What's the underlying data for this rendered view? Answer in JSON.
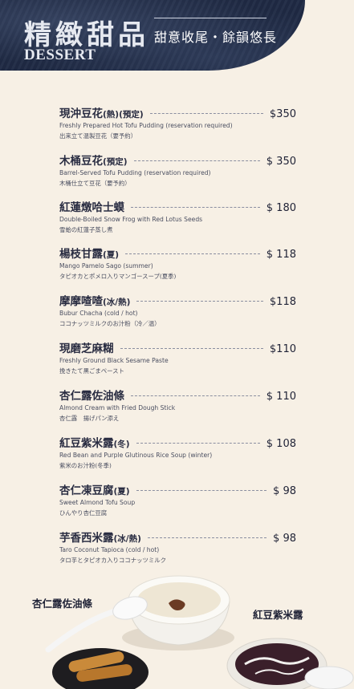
{
  "header": {
    "title_cn": "精緻甜品",
    "title_en": "DESSERT",
    "subtitle": "甜意收尾・餘韻悠長"
  },
  "items": [
    {
      "name": "現沖豆花",
      "tag": "(熱)(預定)",
      "price": "$350",
      "en": "Freshly Prepared Hot Tofu Pudding  (reservation required)",
      "jp": "出来立て温製豆花（要予約）"
    },
    {
      "name": "木桶豆花",
      "tag": "(預定)",
      "price": "$ 350",
      "en": "Barrel-Served Tofu Pudding (reservation required)",
      "jp": "木桶仕立て豆花（要予約）"
    },
    {
      "name": "紅蓮燉哈士蟆",
      "tag": "",
      "price": "$ 180",
      "en": "Double-Boiled Snow Frog with Red Lotus Seeds",
      "jp": "雪蛤の紅蓮子蒸し煮"
    },
    {
      "name": "楊枝甘露",
      "tag": "(夏)",
      "price": "$ 118",
      "en": "Mango Pamelo Sago (summer)",
      "jp": "タピオカとポメロ入りマンゴースープ(夏季)"
    },
    {
      "name": "摩摩喳喳",
      "tag": "(冰/熱)",
      "price": "$118",
      "en": "Bubur Chacha  (cold / hot)",
      "jp": "ココナッツミルクのお汁粉（冷／温）"
    },
    {
      "name": "現磨芝麻糊",
      "tag": "",
      "price": "$110",
      "en": "Freshly Ground Black Sesame Paste",
      "jp": "挽きたて黒ごまペースト"
    },
    {
      "name": "杏仁露佐油條",
      "tag": "",
      "price": "$ 110",
      "en": "Almond Cream with Fried Dough Stick",
      "jp": "杏仁露　揚げパン添え"
    },
    {
      "name": "紅豆紫米露",
      "tag": "(冬)",
      "price": "$ 108",
      "en": "Red Bean and Purple Glutinous Rice Soup (winter)",
      "jp": "紫米のお汁粉(冬季)"
    },
    {
      "name": "杏仁凍豆腐",
      "tag": "(夏)",
      "price": "$ 98",
      "en": "Sweet Almond Tofu Soup",
      "jp": "ひんやり杏仁豆腐"
    },
    {
      "name": "芋香西米露",
      "tag": "(冰/熱)",
      "price": "$ 98",
      "en": "Taro Coconut Tapioca (cold / hot)",
      "jp": "タロ芋とタピオカ入りココナッツミルク"
    }
  ],
  "photos": {
    "left_label": "杏仁露佐油條",
    "right_label": "紅豆紫米露"
  },
  "colors": {
    "header_bg": "#1f2a44",
    "page_bg": "#f7f0e5",
    "text": "#2a2d42"
  }
}
